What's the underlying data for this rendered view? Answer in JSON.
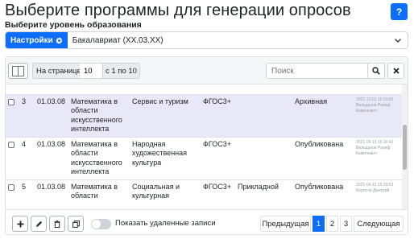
{
  "header": {
    "title": "Выберите программы для генерации опросов",
    "help_label": "?"
  },
  "level": {
    "section_label": "Выберите уровень образования",
    "settings_label": "Настройки",
    "selected": "Бакалавриат (XX.03.XX)"
  },
  "toolbar": {
    "per_page_label": "На странице",
    "per_page_value": "10",
    "range_label": "с 1 по 10",
    "search_placeholder": "Поиск"
  },
  "rows": [
    {
      "num": "3",
      "code": "01.03.08",
      "program": "Математика в области искусственного интеллекта",
      "profile": "Сервис и туризм",
      "standard": "ФГОС3+",
      "type": "",
      "status": "Архивная",
      "meta": "2021-12-01 11:16:09 Вильданов Раниф Камилевич"
    },
    {
      "num": "4",
      "code": "01.03.08",
      "program": "Математика в области искусственного интеллекта",
      "profile": "Народная художественная культура",
      "standard": "ФГОС3+",
      "type": "",
      "status": "Опубликована",
      "meta": "2021-09-13 15:16:42 Вильданов Раниф Камилевич"
    },
    {
      "num": "5",
      "code": "01.03.08",
      "program": "Математика в области",
      "profile": "Социальная и культурная",
      "standard": "ФГОС3+",
      "type": "Прикладной",
      "status": "Опубликована",
      "meta": "2021-04-15 15:29:53 Борисов Дмитрий"
    }
  ],
  "footer": {
    "show_deleted_label": "Показать удаленные записи",
    "prev_label": "Предыдущая",
    "pages": [
      "1",
      "2",
      "3"
    ],
    "next_label": "Следующая"
  }
}
